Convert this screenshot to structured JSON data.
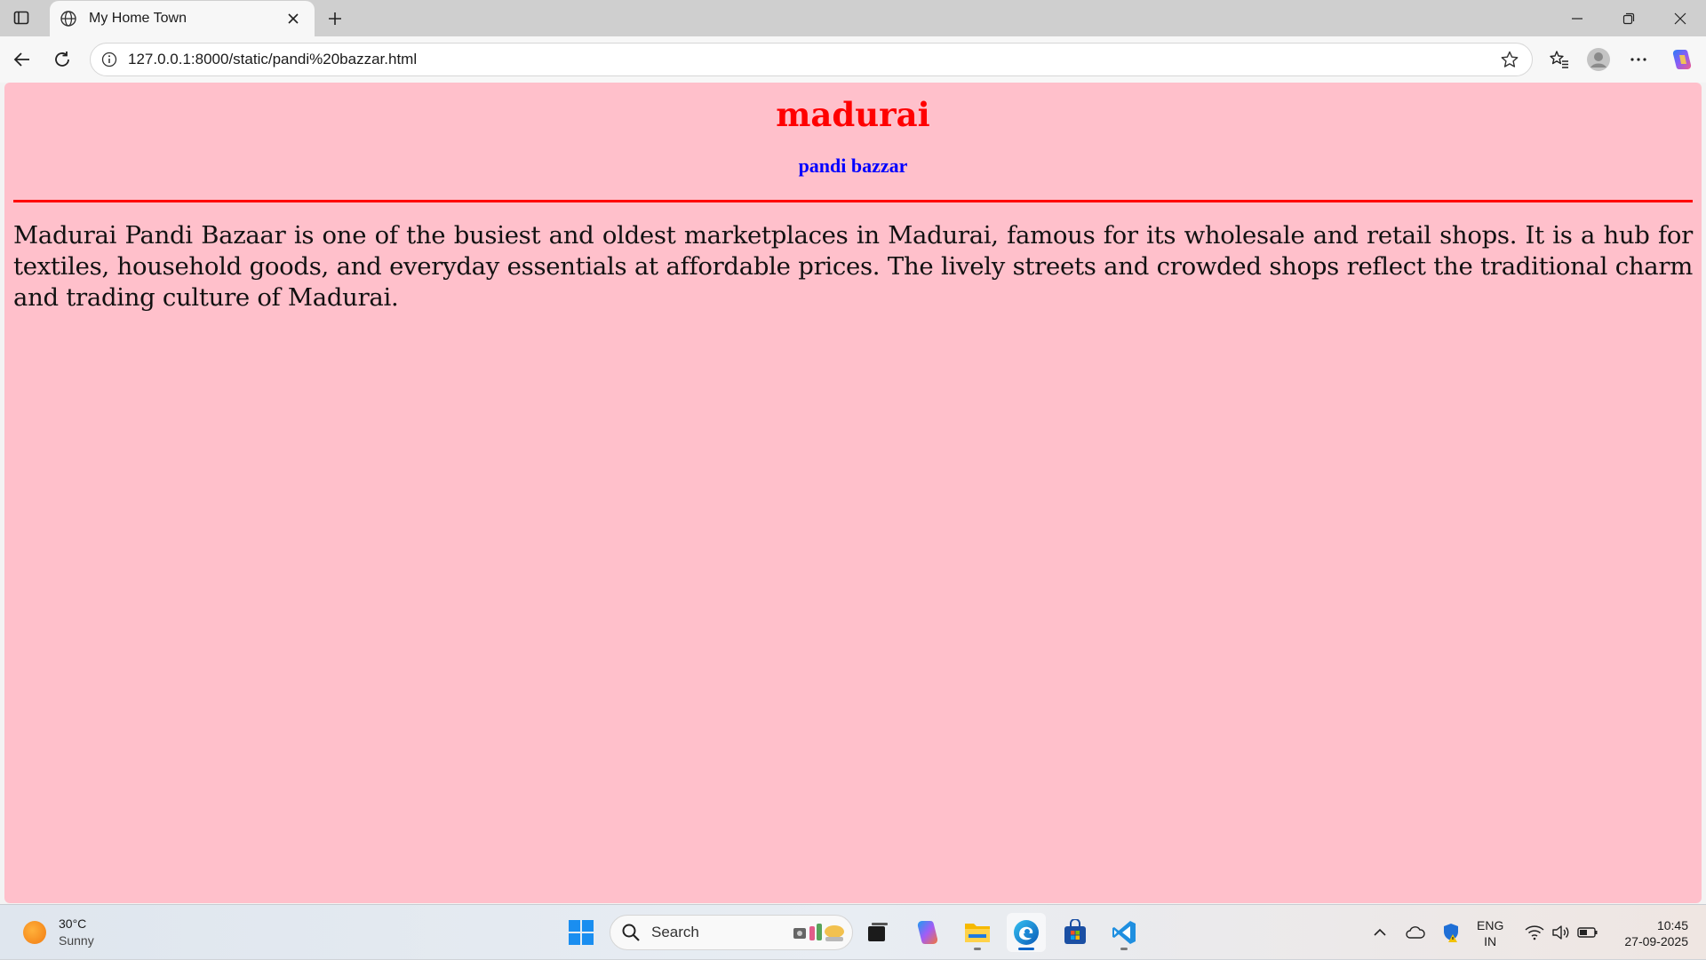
{
  "browser": {
    "tab": {
      "title": "My Home Town",
      "favicon": "globe-icon"
    },
    "url": "127.0.0.1:8000/static/pandi%20bazzar.html"
  },
  "page": {
    "heading": "madurai",
    "subheading": "pandi bazzar",
    "paragraph": "Madurai Pandi Bazaar is one of the busiest and oldest marketplaces in Madurai, famous for its wholesale and retail shops. It is a hub for textiles, household goods, and everyday essentials at affordable prices. The lively streets and crowded shops reflect the traditional charm and trading culture of Madurai.",
    "colors": {
      "background": "#ffc0cb",
      "heading": "#ff0000",
      "subheading": "#0000ff",
      "rule": "#ff0000"
    }
  },
  "taskbar": {
    "weather": {
      "temp": "30°C",
      "condition": "Sunny"
    },
    "search_label": "Search",
    "lang": {
      "line1": "ENG",
      "line2": "IN"
    },
    "clock": {
      "time": "10:45",
      "date": "27-09-2025"
    }
  }
}
